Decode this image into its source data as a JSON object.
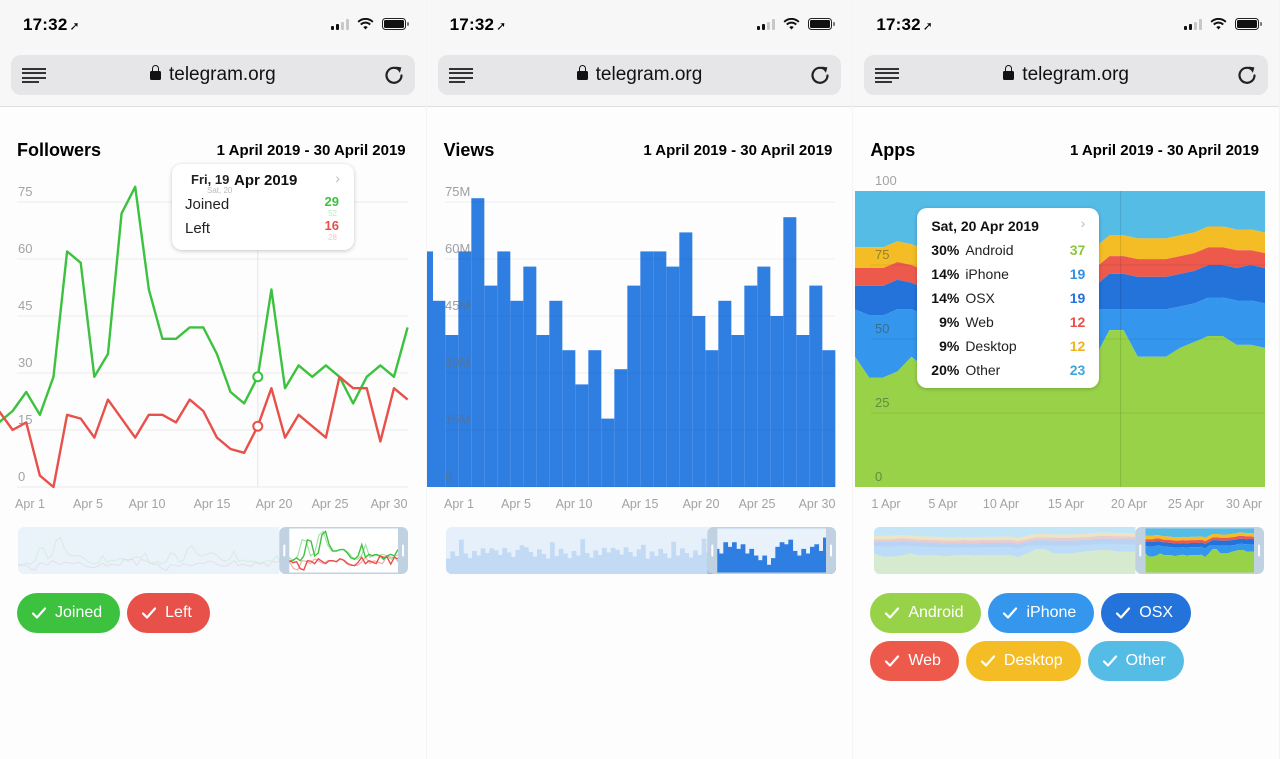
{
  "status_bar": {
    "time": "17:32",
    "location_icon": "location-arrow-icon",
    "signal_bars": 2,
    "signal_total": 4,
    "wifi": "wifi-icon",
    "battery": "battery-icon"
  },
  "browser": {
    "url": "telegram.org",
    "menu_icon": "reader-menu-icon",
    "lock_icon": "lock-icon",
    "reload_icon": "reload-icon"
  },
  "colors": {
    "joined": "#3cc23f",
    "left": "#e8504a",
    "views": "#2f7fe3",
    "android": "#98d249",
    "iphone": "#3497ed",
    "osx": "#2373db",
    "web": "#ed5a4c",
    "desktop": "#f5bd25",
    "other": "#55bce6",
    "grid": "#ececec",
    "axis_text": "#a0a3a6"
  },
  "panels": [
    {
      "title": "Followers",
      "range": "1 April 2019 - 30 April 2019",
      "tooltip": {
        "date": "Fri, 19 Apr 2019",
        "date_prev": "Fri, 19",
        "date_next": "Sat, 20",
        "date_suffix": "Apr 2019",
        "rows": [
          {
            "label": "Joined",
            "value": "29",
            "value_next": "52",
            "color": "#3cc23f"
          },
          {
            "label": "Left",
            "value": "16",
            "value_next": "28",
            "color": "#e8504a"
          }
        ]
      },
      "toggles": [
        {
          "label": "Joined",
          "color": "#3cc23f",
          "checked": true
        },
        {
          "label": "Left",
          "color": "#e8504a",
          "checked": true
        }
      ]
    },
    {
      "title": "Views",
      "range": "1 April 2019 - 30 April 2019"
    },
    {
      "title": "Apps",
      "range": "1 April 2019 - 30 April 2019",
      "tooltip": {
        "date": "Sat, 20 Apr 2019",
        "rows": [
          {
            "pct": "30%",
            "label": "Android",
            "value": "37",
            "color": "#8cc63f"
          },
          {
            "pct": "14%",
            "label": "iPhone",
            "value": "19",
            "color": "#2f8fe0"
          },
          {
            "pct": "14%",
            "label": "OSX",
            "value": "19",
            "color": "#2373db"
          },
          {
            "pct": "9%",
            "label": "Web",
            "value": "12",
            "color": "#e8504a"
          },
          {
            "pct": "9%",
            "label": "Desktop",
            "value": "12",
            "color": "#efb31d"
          },
          {
            "pct": "20%",
            "label": "Other",
            "value": "23",
            "color": "#3aa8dd"
          }
        ]
      },
      "toggles": [
        {
          "label": "Android",
          "color": "#98d249",
          "checked": true
        },
        {
          "label": "iPhone",
          "color": "#3497ed",
          "checked": true
        },
        {
          "label": "OSX",
          "color": "#2373db",
          "checked": true
        },
        {
          "label": "Web",
          "color": "#ed5a4c",
          "checked": true
        },
        {
          "label": "Desktop",
          "color": "#f5bd25",
          "checked": true
        },
        {
          "label": "Other",
          "color": "#55bce6",
          "checked": true
        }
      ]
    }
  ],
  "chart_data": [
    {
      "type": "line",
      "title": "Followers",
      "x": [
        "Mar 31",
        "Apr 1",
        "Apr 2",
        "Apr 3",
        "Apr 4",
        "Apr 5",
        "Apr 6",
        "Apr 7",
        "Apr 8",
        "Apr 9",
        "Apr 10",
        "Apr 11",
        "Apr 12",
        "Apr 13",
        "Apr 14",
        "Apr 15",
        "Apr 16",
        "Apr 17",
        "Apr 18",
        "Apr 19",
        "Apr 20",
        "Apr 21",
        "Apr 22",
        "Apr 23",
        "Apr 24",
        "Apr 25",
        "Apr 26",
        "Apr 27",
        "Apr 28",
        "Apr 29",
        "Apr 30"
      ],
      "x_tick_labels": [
        "Apr 1",
        "Apr 5",
        "Apr 10",
        "Apr 15",
        "Apr 20",
        "Apr 25",
        "Apr 30"
      ],
      "y_tick_labels": [
        "0",
        "15",
        "30",
        "45",
        "60",
        "75"
      ],
      "ylim": [
        0,
        80
      ],
      "series": [
        {
          "name": "Joined",
          "color": "#3cc23f",
          "values": [
            17,
            20,
            25,
            19,
            29,
            62,
            59,
            29,
            35,
            72,
            79,
            52,
            39,
            39,
            42,
            42,
            35,
            25,
            22,
            29,
            52,
            26,
            32,
            29,
            32,
            29,
            22,
            29,
            32,
            29,
            42
          ]
        },
        {
          "name": "Left",
          "color": "#e8504a",
          "values": [
            20,
            15,
            17,
            3,
            0,
            19,
            18,
            13,
            23,
            18,
            13,
            19,
            19,
            17,
            23,
            20,
            13,
            10,
            9,
            16,
            26,
            13,
            19,
            16,
            13,
            29,
            26,
            26,
            12,
            26,
            23
          ]
        }
      ],
      "highlight": {
        "index": 19,
        "label": "Apr 19"
      },
      "grid": true,
      "minimap_window": [
        0.67,
        1.0
      ]
    },
    {
      "type": "bar",
      "title": "Views",
      "x": [
        "Mar 31",
        "Apr 1",
        "Apr 2",
        "Apr 3",
        "Apr 4",
        "Apr 5",
        "Apr 6",
        "Apr 7",
        "Apr 8",
        "Apr 9",
        "Apr 10",
        "Apr 11",
        "Apr 12",
        "Apr 13",
        "Apr 14",
        "Apr 15",
        "Apr 16",
        "Apr 17",
        "Apr 18",
        "Apr 19",
        "Apr 20",
        "Apr 21",
        "Apr 22",
        "Apr 23",
        "Apr 24",
        "Apr 25",
        "Apr 26",
        "Apr 27",
        "Apr 28",
        "Apr 29",
        "Apr 30",
        "May 1"
      ],
      "x_tick_labels": [
        "Apr 1",
        "Apr 5",
        "Apr 10",
        "Apr 15",
        "Apr 20",
        "Apr 25",
        "Apr 30"
      ],
      "y_tick_labels": [
        "0",
        "15M",
        "30M",
        "45M",
        "60M",
        "75M"
      ],
      "ylim": [
        0,
        78
      ],
      "unit": "M",
      "series": [
        {
          "name": "Views",
          "color": "#2f7fe3",
          "values": [
            62,
            49,
            40,
            62,
            76,
            53,
            62,
            49,
            58,
            40,
            49,
            36,
            27,
            36,
            18,
            31,
            53,
            62,
            62,
            58,
            67,
            45,
            36,
            49,
            40,
            53,
            58,
            45,
            71,
            40,
            53,
            36
          ]
        }
      ],
      "grid": true,
      "minimap_window": [
        0.67,
        1.0
      ]
    },
    {
      "type": "area",
      "stacked": true,
      "percentage": true,
      "title": "Apps",
      "x": [
        "1 Apr",
        "2 Apr",
        "3 Apr",
        "4 Apr",
        "5 Apr",
        "6 Apr",
        "7 Apr",
        "8 Apr",
        "9 Apr",
        "10 Apr",
        "11 Apr",
        "12 Apr",
        "13 Apr",
        "14 Apr",
        "15 Apr",
        "16 Apr",
        "17 Apr",
        "18 Apr",
        "19 Apr",
        "20 Apr",
        "21 Apr",
        "22 Apr",
        "23 Apr",
        "24 Apr",
        "25 Apr",
        "26 Apr",
        "27 Apr",
        "28 Apr",
        "29 Apr",
        "30 Apr"
      ],
      "x_tick_labels": [
        "1 Apr",
        "5 Apr",
        "10 Apr",
        "15 Apr",
        "20 Apr",
        "25 Apr",
        "30 Apr"
      ],
      "y_tick_labels": [
        "0",
        "25",
        "50",
        "75",
        "100"
      ],
      "ylim": [
        0,
        100
      ],
      "series": [
        {
          "name": "Android",
          "color": "#98d249",
          "values": [
            44,
            37,
            37,
            39,
            44,
            40,
            40,
            40,
            38,
            40,
            41,
            39,
            40,
            40,
            40,
            41,
            36,
            44,
            53,
            53,
            44,
            44,
            44,
            47,
            49,
            51,
            51,
            48,
            48,
            47
          ]
        },
        {
          "name": "iPhone",
          "color": "#3497ed",
          "values": [
            16,
            21,
            21,
            21,
            16,
            18,
            18,
            17,
            18,
            16,
            16,
            17,
            17,
            17,
            17,
            17,
            18,
            16,
            7,
            7,
            16,
            16,
            16,
            14,
            13,
            13,
            13,
            15,
            15,
            15
          ]
        },
        {
          "name": "OSX",
          "color": "#2373db",
          "values": [
            8,
            10,
            10,
            10,
            9,
            9,
            9,
            9,
            9,
            9,
            9,
            9,
            9,
            9,
            9,
            9,
            10,
            8,
            12,
            12,
            11,
            11,
            11,
            11,
            11,
            11,
            11,
            11,
            12,
            12
          ]
        },
        {
          "name": "Web",
          "color": "#ed5a4c",
          "values": [
            6,
            6,
            6,
            6,
            6,
            6,
            6,
            6,
            6,
            6,
            6,
            6,
            6,
            6,
            6,
            6,
            6,
            6,
            6,
            6,
            6,
            6,
            6,
            6,
            6,
            6,
            6,
            6,
            5,
            5
          ]
        },
        {
          "name": "Desktop",
          "color": "#f5bd25",
          "values": [
            7,
            7,
            7,
            7,
            7,
            7,
            7,
            7,
            7,
            7,
            7,
            7,
            7,
            7,
            7,
            7,
            7,
            7,
            7,
            7,
            7,
            7,
            7,
            7,
            7,
            7,
            7,
            7,
            7,
            7
          ]
        },
        {
          "name": "Other",
          "color": "#55bce6",
          "values": [
            19,
            19,
            19,
            17,
            18,
            20,
            20,
            21,
            22,
            22,
            21,
            22,
            21,
            21,
            21,
            20,
            23,
            19,
            15,
            15,
            16,
            16,
            16,
            15,
            14,
            12,
            12,
            13,
            13,
            14
          ]
        }
      ],
      "highlight": {
        "index": 19,
        "label": "20 Apr"
      },
      "grid": true,
      "minimap_window": [
        0.67,
        1.0
      ]
    }
  ]
}
